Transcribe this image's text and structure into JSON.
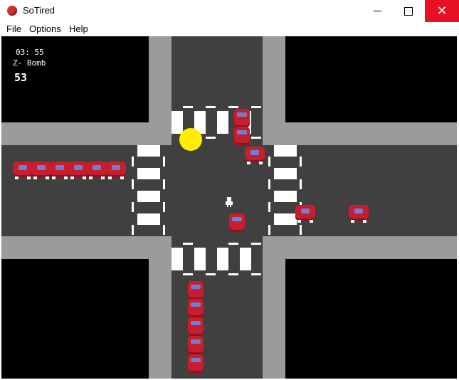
{
  "window": {
    "title": "SoTired"
  },
  "menu": [
    "File",
    "Options",
    "Help"
  ],
  "hud": {
    "time": "03: 55",
    "weapon": "Z- Bomb",
    "score": "53"
  },
  "colors": {
    "road": "#404040",
    "sidewalk": "#9b9b9b",
    "car": "#c81e2c",
    "sun": "#ffee00",
    "close_button": "#e81123"
  }
}
